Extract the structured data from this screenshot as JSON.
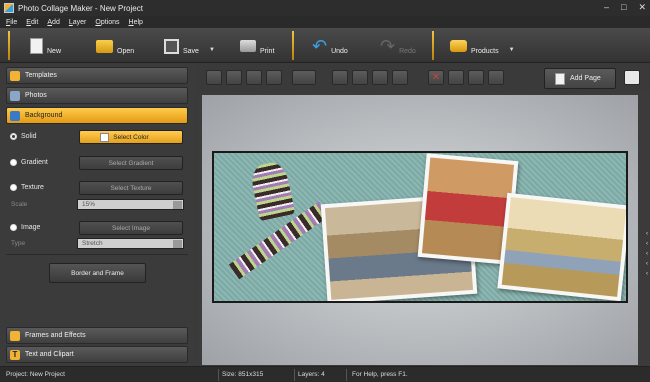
{
  "window": {
    "title": "Photo Collage Maker - New Project",
    "controls": [
      "minimize",
      "maximize",
      "close"
    ]
  },
  "menu": [
    "File",
    "Edit",
    "Add",
    "Layer",
    "Options",
    "Help"
  ],
  "toolbar": {
    "new_label": "New",
    "open_label": "Open",
    "save_label": "Save",
    "print_label": "Print",
    "undo_label": "Undo",
    "redo_label": "Redo",
    "products_label": "Products"
  },
  "panel": {
    "templates": "Templates",
    "photos": "Photos",
    "background": "Background",
    "solid_label": "Solid",
    "select_color": "Select Color",
    "gradient_label": "Gradient",
    "select_gradient": "Select Gradient",
    "texture_label": "Texture",
    "select_texture": "Select Texture",
    "scale_label": "Scale",
    "scale_value": "15%",
    "image_label": "Image",
    "select_image": "Select Image",
    "type_label": "Type",
    "type_value": "Stretch",
    "border_frame": "Border and Frame",
    "frames_effects": "Frames and Effects",
    "text_clipart": "Text and Clipart"
  },
  "canvas": {
    "add_page": "Add Page"
  },
  "status": {
    "project": "Project: New Project",
    "size": "Size: 851x315",
    "layers": "Layers: 4",
    "help": "For Help, press F1."
  },
  "colors": {
    "accent": "#f2b233",
    "panel_bg": "#3b3b3b",
    "collage_bg": "#8cb8b3"
  }
}
